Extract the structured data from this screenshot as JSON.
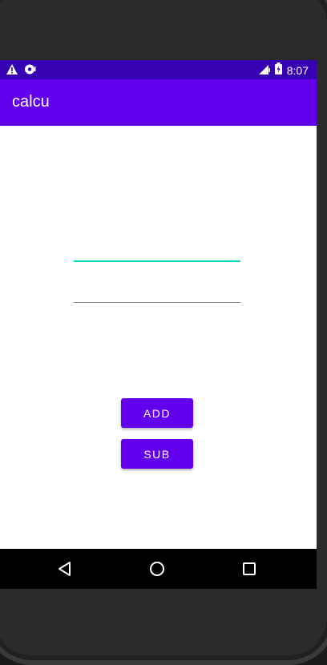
{
  "status_bar": {
    "time": "8:07",
    "icons": [
      "warning-icon",
      "sim-icon",
      "signal-icon",
      "battery-icon"
    ]
  },
  "app_bar": {
    "title": "calcu"
  },
  "form": {
    "input1_value": "",
    "input2_value": ""
  },
  "buttons": {
    "add_label": "ADD",
    "sub_label": "SUB"
  },
  "nav": {
    "icons": [
      "back-icon",
      "home-icon",
      "recents-icon"
    ]
  },
  "colors": {
    "primary": "#6200ee",
    "primary_dark": "#3700b3",
    "accent": "#03dac5",
    "background": "#ffffff"
  }
}
